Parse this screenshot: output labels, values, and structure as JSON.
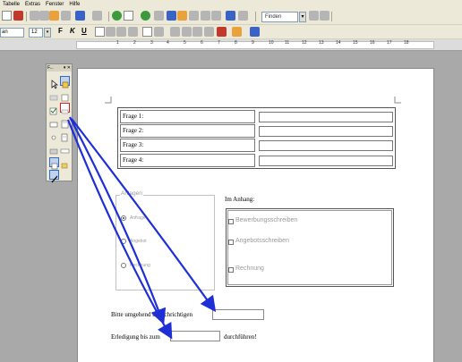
{
  "menubar": {
    "items": [
      "Tabelle",
      "Extras",
      "Fenster",
      "Hilfe"
    ]
  },
  "toolbar": {
    "find_placeholder": "Finden",
    "font_name": "an",
    "font_size": "12",
    "format": {
      "bold": "F",
      "italic": "K",
      "underline": "U"
    }
  },
  "ruler": {
    "numbers": [
      "1",
      "2",
      "3",
      "4",
      "5",
      "6",
      "7",
      "8",
      "9",
      "10",
      "11",
      "12",
      "13",
      "14",
      "15",
      "16",
      "17",
      "18"
    ]
  },
  "toolbox": {
    "title": "F...",
    "close_label": "▾ ✕",
    "icons": [
      "select-icon",
      "design-mode-icon",
      "push-button-icon",
      "option-button-icon",
      "checkbox-icon",
      "label-icon",
      "text-box-icon",
      "list-box-icon",
      "combo-box-icon",
      "group-box-icon",
      "image-button-icon",
      "more-controls-icon",
      "form-design-icon",
      "wizards-icon"
    ]
  },
  "form": {
    "questions": [
      "Frage 1:",
      "Frage 2:",
      "Frage 3:",
      "Frage 4:"
    ],
    "group_title": "Anlagen",
    "radios": [
      {
        "label": "Anfrage",
        "selected": true
      },
      {
        "label": "Angebot",
        "selected": false
      },
      {
        "label": "Rechnung",
        "selected": false
      }
    ],
    "anhang_title": "Im Anhang:",
    "checkboxes": [
      "Bewerbungsschreiben",
      "Angebotsschreiben",
      "Rechnung"
    ],
    "notify_text": "Bitte umgehend benachrichtigen",
    "deadline_prefix": "Erledigung bis zum",
    "deadline_suffix": "durchführen!"
  },
  "colors": {
    "annotation_arrow": "#1f2fd6",
    "toolbar_bg": "#ece9d8",
    "workspace_bg": "#a9a9a9"
  }
}
